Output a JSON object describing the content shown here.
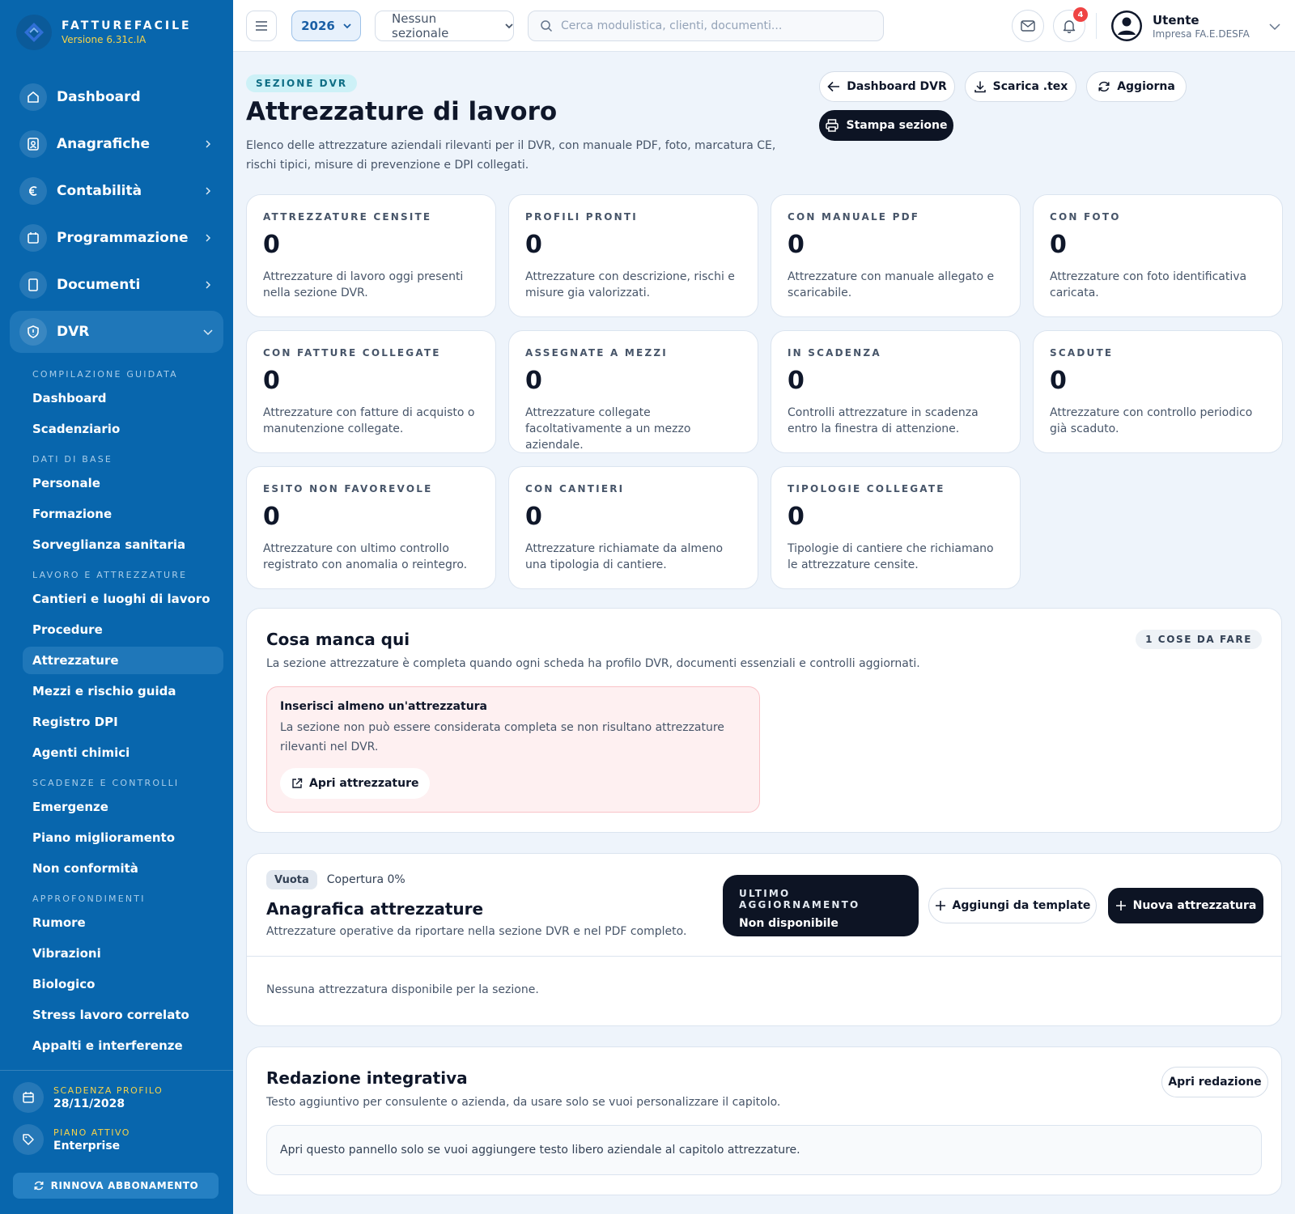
{
  "brand": {
    "name": "FATTUREFACILE",
    "version": "Versione 6.31c.IA"
  },
  "sidebar": {
    "main_items": [
      {
        "label": "Dashboard",
        "icon": "home-icon",
        "has_chevron": false
      },
      {
        "label": "Anagrafiche",
        "icon": "contacts-icon",
        "has_chevron": true
      },
      {
        "label": "Contabilità",
        "icon": "euro-icon",
        "has_chevron": true
      },
      {
        "label": "Programmazione",
        "icon": "calendar-icon",
        "has_chevron": true
      },
      {
        "label": "Documenti",
        "icon": "document-icon",
        "has_chevron": true
      },
      {
        "label": "DVR",
        "icon": "shield-icon",
        "has_chevron": true,
        "expanded": true
      }
    ],
    "groups": [
      {
        "heading": "COMPILAZIONE GUIDATA",
        "items": [
          "Dashboard",
          "Scadenziario"
        ]
      },
      {
        "heading": "DATI DI BASE",
        "items": [
          "Personale",
          "Formazione",
          "Sorveglianza sanitaria"
        ]
      },
      {
        "heading": "LAVORO E ATTREZZATURE",
        "items": [
          "Cantieri e luoghi di lavoro",
          "Procedure",
          "Attrezzature",
          "Mezzi e rischio guida",
          "Registro DPI",
          "Agenti chimici"
        ]
      },
      {
        "heading": "SCADENZE E CONTROLLI",
        "items": [
          "Emergenze",
          "Piano miglioramento",
          "Non conformità"
        ]
      },
      {
        "heading": "APPROFONDIMENTI",
        "items": [
          "Rumore",
          "Vibrazioni",
          "Biologico",
          "Stress lavoro correlato",
          "Appalti e interferenze"
        ]
      }
    ],
    "active_sub_item": "Attrezzature",
    "footer": {
      "expiry_label": "SCADENZA PROFILO",
      "expiry_value": "28/11/2028",
      "plan_label": "PIANO ATTIVO",
      "plan_value": "Enterprise",
      "renew_label": "RINNOVA ABBONAMENTO"
    }
  },
  "topbar": {
    "year": "2026",
    "sezionale": "Nessun sezionale",
    "search_placeholder": "Cerca modulistica, clienti, documenti...",
    "notification_count": "4",
    "user_name": "Utente",
    "user_org": "Impresa FA.E.DESFA"
  },
  "page": {
    "section_tag": "SEZIONE DVR",
    "title": "Attrezzature di lavoro",
    "description": "Elenco delle attrezzature aziendali rilevanti per il DVR, con manuale PDF, foto, marcatura CE, rischi tipici, misure di prevenzione e DPI collegati.",
    "actions": {
      "dashboard": "Dashboard DVR",
      "download": "Scarica .tex",
      "refresh": "Aggiorna",
      "print": "Stampa sezione"
    }
  },
  "stats": [
    {
      "label": "ATTREZZATURE CENSITE",
      "value": "0",
      "desc": "Attrezzature di lavoro oggi presenti nella sezione DVR."
    },
    {
      "label": "PROFILI PRONTI",
      "value": "0",
      "desc": "Attrezzature con descrizione, rischi e misure gia valorizzati."
    },
    {
      "label": "CON MANUALE PDF",
      "value": "0",
      "desc": "Attrezzature con manuale allegato e scaricabile."
    },
    {
      "label": "CON FOTO",
      "value": "0",
      "desc": "Attrezzature con foto identificativa caricata."
    },
    {
      "label": "CON FATTURE COLLEGATE",
      "value": "0",
      "desc": "Attrezzature con fatture di acquisto o manutenzione collegate."
    },
    {
      "label": "ASSEGNATE A MEZZI",
      "value": "0",
      "desc": "Attrezzature collegate facoltativamente a un mezzo aziendale."
    },
    {
      "label": "IN SCADENZA",
      "value": "0",
      "desc": "Controlli attrezzature in scadenza entro la finestra di attenzione."
    },
    {
      "label": "SCADUTE",
      "value": "0",
      "desc": "Attrezzature con controllo periodico già scaduto."
    },
    {
      "label": "ESITO NON FAVOREVOLE",
      "value": "0",
      "desc": "Attrezzature con ultimo controllo registrato con anomalia o reintegro."
    },
    {
      "label": "CON CANTIERI",
      "value": "0",
      "desc": "Attrezzature richiamate da almeno una tipologia di cantiere."
    },
    {
      "label": "TIPOLOGIE COLLEGATE",
      "value": "0",
      "desc": "Tipologie di cantiere che richiamano le attrezzature censite."
    }
  ],
  "missing": {
    "title": "Cosa manca qui",
    "subtitle": "La sezione attrezzature è completa quando ogni scheda ha profilo DVR, documenti essenziali e controlli aggiornati.",
    "todo_badge": "1 COSE DA FARE",
    "alert_title": "Inserisci almeno un'attrezzatura",
    "alert_text": "La sezione non può essere considerata completa se non risultano attrezzature rilevanti nel DVR.",
    "alert_button": "Apri attrezzature"
  },
  "registry": {
    "chip": "Vuota",
    "coverage": "Copertura 0%",
    "title": "Anagrafica attrezzature",
    "subtitle": "Attrezzature operative da riportare nella sezione DVR e nel PDF completo.",
    "last_update_label": "ULTIMO AGGIORNAMENTO",
    "last_update_value": "Non disponibile",
    "add_template": "Aggiungi da template",
    "new_item": "Nuova attrezzatura",
    "empty": "Nessuna attrezzatura disponibile per la sezione."
  },
  "redaction": {
    "title": "Redazione integrativa",
    "subtitle": "Testo aggiuntivo per consulente o azienda, da usare solo se vuoi personalizzare il capitolo.",
    "open_button": "Apri redazione",
    "placeholder_text": "Apri questo pannello solo se vuoi aggiungere testo libero aziendale al capitolo attrezzature."
  },
  "colors": {
    "sidebar": "#0866ad",
    "accent_yellow": "#f6d34a",
    "dark": "#0d1424",
    "alert_bg": "#fef0f1",
    "badge_red": "#ef4444"
  }
}
